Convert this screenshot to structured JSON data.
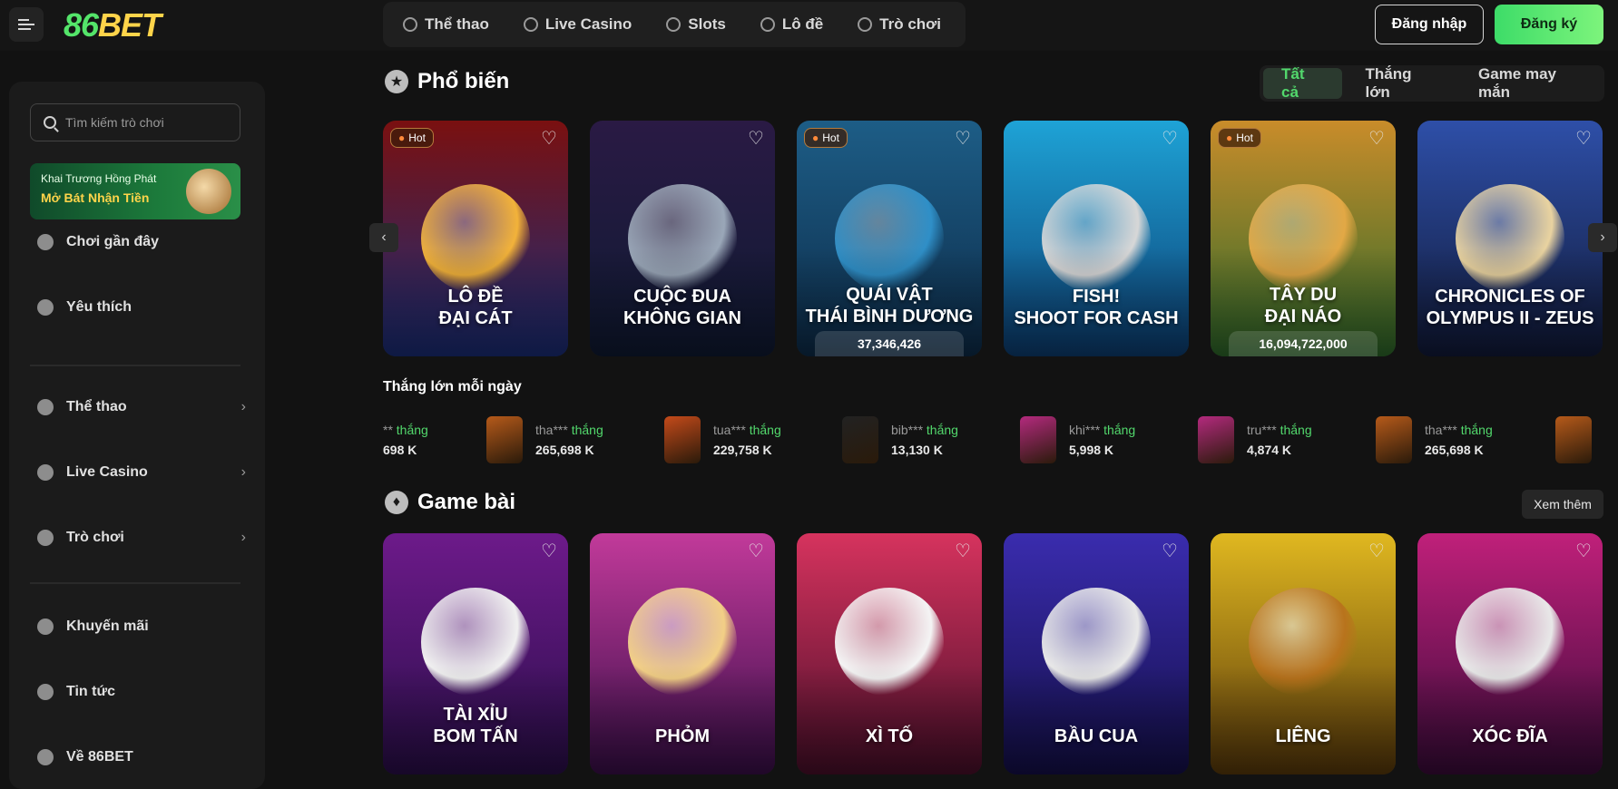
{
  "header": {
    "logo_text_a": "86",
    "logo_text_b": "BET",
    "nav": [
      {
        "label": "Thể thao",
        "icon": "soccer-ball-icon"
      },
      {
        "label": "Live Casino",
        "icon": "roulette-icon"
      },
      {
        "label": "Slots",
        "icon": "slot-icon"
      },
      {
        "label": "Lô đề",
        "icon": "lottery-icon"
      },
      {
        "label": "Trò chơi",
        "icon": "game-icon"
      }
    ],
    "login_label": "Đăng nhập",
    "register_label": "Đăng ký"
  },
  "sidebar": {
    "search_placeholder": "Tìm kiếm trò chơi",
    "promo_line1": "Khai Trương Hồng Phát",
    "promo_line2": "Mở Bát Nhận Tiền",
    "items": [
      {
        "label": "Chơi gần đây",
        "icon": "clock-icon"
      },
      {
        "label": "Yêu thích",
        "icon": "heart-icon"
      },
      {
        "label": "Thể thao",
        "icon": "soccer-ball-icon",
        "chevron": "›"
      },
      {
        "label": "Live Casino",
        "icon": "roulette-icon",
        "chevron": "›"
      },
      {
        "label": "Trò chơi",
        "icon": "game-icon",
        "chevron": "›"
      },
      {
        "label": "Khuyến mãi",
        "icon": "gift-icon"
      },
      {
        "label": "Tin tức",
        "icon": "news-icon"
      },
      {
        "label": "Về 86BET",
        "icon": "info-icon"
      }
    ]
  },
  "popular": {
    "title": "Phổ biến",
    "filters": [
      "Tất cả",
      "Thắng lớn",
      "Game may mắn"
    ],
    "hot_label": "Hot",
    "cards": [
      {
        "title_line1": "LÔ ĐỀ",
        "title_line2": "ĐẠI CÁT",
        "jackpot": "",
        "hot": true,
        "bg": "#7a1010",
        "bg2": "#1a2e7a",
        "blob": "#f2b23a"
      },
      {
        "title_line1": "CUỘC ĐUA",
        "title_line2": "KHÔNG GIAN",
        "jackpot": "",
        "hot": false,
        "bg": "#2a1a44",
        "bg2": "#0f1a33",
        "blob": "#9aa7b8"
      },
      {
        "title_line1": "QUÁI VẬT",
        "title_line2": "THÁI BÌNH DƯƠNG",
        "jackpot": "37,346,426",
        "hot": true,
        "bg": "#1d5d86",
        "bg2": "#0d2c4a",
        "blob": "#2f8fc7"
      },
      {
        "title_line1": "FISH!",
        "title_line2": "SHOOT FOR CASH",
        "jackpot": "",
        "hot": false,
        "bg": "#1ea3d6",
        "bg2": "#0c3e73",
        "blob": "#d7d7d7"
      },
      {
        "title_line1": "TÂY DU",
        "title_line2": "ĐẠI NÁO",
        "jackpot": "16,094,722,000",
        "hot": true,
        "bg": "#c98c2a",
        "bg2": "#2d6a2b",
        "blob": "#e2a845"
      },
      {
        "title_line1": "CHRONICLES OF",
        "title_line2": "OLYMPUS II - ZEUS",
        "jackpot": "",
        "hot": false,
        "bg": "#2e4fa8",
        "bg2": "#111a3a",
        "blob": "#e9d3a0"
      }
    ]
  },
  "winners": {
    "title": "Thắng lớn mỗi ngày",
    "won_label": "thắng",
    "items": [
      {
        "user": "**",
        "amount": "698 K",
        "thumb": "#b65a1a"
      },
      {
        "user": "tha***",
        "amount": "265,698 K",
        "thumb": "#b65a1a"
      },
      {
        "user": "tua***",
        "amount": "229,758 K",
        "thumb": "#c44a1a"
      },
      {
        "user": "bib***",
        "amount": "13,130 K",
        "thumb": "#222222"
      },
      {
        "user": "khi***",
        "amount": "5,998 K",
        "thumb": "#b42a7e"
      },
      {
        "user": "tru***",
        "amount": "4,874 K",
        "thumb": "#b42a7e"
      },
      {
        "user": "tha***",
        "amount": "265,698 K",
        "thumb": "#b65a1a"
      }
    ]
  },
  "card_games": {
    "title": "Game bài",
    "more_label": "Xem thêm",
    "cards": [
      {
        "title_line1": "TÀI XỈU",
        "title_line2": "BOM TẤN",
        "bg": "#6d1a8a",
        "bg2": "#2a0e4a",
        "blob": "#f0f0f0"
      },
      {
        "title_line1": "",
        "title_line2": "PHỎM",
        "bg": "#c23a9a",
        "bg2": "#3a0e4a",
        "blob": "#f2cf86"
      },
      {
        "title_line1": "",
        "title_line2": "XÌ TỐ",
        "bg": "#d6335e",
        "bg2": "#4a0e2a",
        "blob": "#f4f4f4"
      },
      {
        "title_line1": "",
        "title_line2": "BẦU CUA",
        "bg": "#3a2cae",
        "bg2": "#140f4a",
        "blob": "#e8e8e8"
      },
      {
        "title_line1": "",
        "title_line2": "LIÊNG",
        "bg": "#e0b820",
        "bg2": "#5a3a0a",
        "blob": "#b8731c"
      },
      {
        "title_line1": "",
        "title_line2": "XÓC ĐĨA",
        "bg": "#c0207a",
        "bg2": "#3a0a3a",
        "blob": "#e8e8e8"
      }
    ]
  },
  "colors": {
    "accent": "#52d86c",
    "brand_yellow": "#ffd44a"
  }
}
